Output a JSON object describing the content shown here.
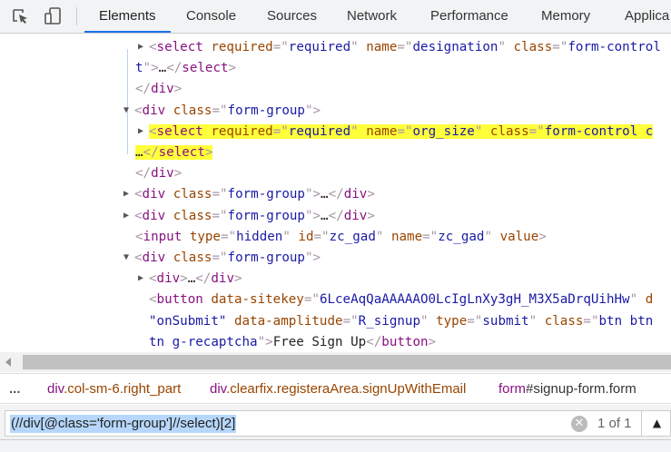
{
  "toolbar": {
    "tabs": [
      "Elements",
      "Console",
      "Sources",
      "Network",
      "Performance",
      "Memory",
      "Applica"
    ],
    "active": "Elements"
  },
  "tree": {
    "lines": [
      {
        "indent": 164,
        "tri": "▶",
        "tokens": [
          [
            "pun",
            "<"
          ],
          [
            "tag",
            "select"
          ],
          [
            "txt",
            " "
          ],
          [
            "attr",
            "required"
          ],
          [
            "pun",
            "=\""
          ],
          [
            "val",
            "required"
          ],
          [
            "pun",
            "\""
          ],
          [
            "txt",
            " "
          ],
          [
            "attr",
            "name"
          ],
          [
            "pun",
            "=\""
          ],
          [
            "val",
            "designation"
          ],
          [
            "pun",
            "\""
          ],
          [
            "txt",
            " "
          ],
          [
            "attr",
            "class"
          ],
          [
            "pun",
            "=\""
          ],
          [
            "val",
            "form-control"
          ]
        ]
      },
      {
        "indent": 149,
        "tokens": [
          [
            "val",
            "t"
          ],
          [
            "pun",
            "\">"
          ],
          [
            "txt",
            "…"
          ],
          [
            "pun",
            "</"
          ],
          [
            "tag",
            "select"
          ],
          [
            "pun",
            ">"
          ]
        ]
      },
      {
        "indent": 149,
        "tokens": [
          [
            "pun",
            "</"
          ],
          [
            "tag",
            "div"
          ],
          [
            "pun",
            ">"
          ]
        ]
      },
      {
        "indent": 148,
        "tri": "▼",
        "tokens": [
          [
            "pun",
            "<"
          ],
          [
            "tag",
            "div"
          ],
          [
            "txt",
            " "
          ],
          [
            "attr",
            "class"
          ],
          [
            "pun",
            "=\""
          ],
          [
            "val",
            "form-group"
          ],
          [
            "pun",
            "\">"
          ]
        ]
      },
      {
        "indent": 164,
        "tri": "▶",
        "hl": true,
        "tokens": [
          [
            "pun",
            "<"
          ],
          [
            "tag",
            "select"
          ],
          [
            "txt",
            " "
          ],
          [
            "attr",
            "required"
          ],
          [
            "pun",
            "=\""
          ],
          [
            "val",
            "required"
          ],
          [
            "pun",
            "\""
          ],
          [
            "txt",
            " "
          ],
          [
            "attr",
            "name"
          ],
          [
            "pun",
            "=\""
          ],
          [
            "val",
            "org_size"
          ],
          [
            "pun",
            "\""
          ],
          [
            "txt",
            " "
          ],
          [
            "attr",
            "class"
          ],
          [
            "pun",
            "=\""
          ],
          [
            "val",
            "form-control c"
          ]
        ]
      },
      {
        "indent": 149,
        "hl": true,
        "tokens": [
          [
            "txt",
            "…"
          ],
          [
            "pun",
            "</"
          ],
          [
            "tag",
            "select"
          ],
          [
            "pun",
            ">"
          ]
        ]
      },
      {
        "indent": 149,
        "tokens": [
          [
            "pun",
            "</"
          ],
          [
            "tag",
            "div"
          ],
          [
            "pun",
            ">"
          ]
        ]
      },
      {
        "indent": 148,
        "tri": "▶",
        "tokens": [
          [
            "pun",
            "<"
          ],
          [
            "tag",
            "div"
          ],
          [
            "txt",
            " "
          ],
          [
            "attr",
            "class"
          ],
          [
            "pun",
            "=\""
          ],
          [
            "val",
            "form-group"
          ],
          [
            "pun",
            "\">"
          ],
          [
            "txt",
            "…"
          ],
          [
            "pun",
            "</"
          ],
          [
            "tag",
            "div"
          ],
          [
            "pun",
            ">"
          ]
        ]
      },
      {
        "indent": 148,
        "tri": "▶",
        "tokens": [
          [
            "pun",
            "<"
          ],
          [
            "tag",
            "div"
          ],
          [
            "txt",
            " "
          ],
          [
            "attr",
            "class"
          ],
          [
            "pun",
            "=\""
          ],
          [
            "val",
            "form-group"
          ],
          [
            "pun",
            "\">"
          ],
          [
            "txt",
            "…"
          ],
          [
            "pun",
            "</"
          ],
          [
            "tag",
            "div"
          ],
          [
            "pun",
            ">"
          ]
        ]
      },
      {
        "indent": 149,
        "tokens": [
          [
            "pun",
            "<"
          ],
          [
            "tag",
            "input"
          ],
          [
            "txt",
            " "
          ],
          [
            "attr",
            "type"
          ],
          [
            "pun",
            "=\""
          ],
          [
            "val",
            "hidden"
          ],
          [
            "pun",
            "\""
          ],
          [
            "txt",
            " "
          ],
          [
            "attr",
            "id"
          ],
          [
            "pun",
            "=\""
          ],
          [
            "val",
            "zc_gad"
          ],
          [
            "pun",
            "\""
          ],
          [
            "txt",
            " "
          ],
          [
            "attr",
            "name"
          ],
          [
            "pun",
            "=\""
          ],
          [
            "val",
            "zc_gad"
          ],
          [
            "pun",
            "\""
          ],
          [
            "txt",
            " "
          ],
          [
            "attr",
            "value"
          ],
          [
            "pun",
            ">"
          ]
        ]
      },
      {
        "indent": 148,
        "tri": "▼",
        "tokens": [
          [
            "pun",
            "<"
          ],
          [
            "tag",
            "div"
          ],
          [
            "txt",
            " "
          ],
          [
            "attr",
            "class"
          ],
          [
            "pun",
            "=\""
          ],
          [
            "val",
            "form-group"
          ],
          [
            "pun",
            "\">"
          ]
        ]
      },
      {
        "indent": 164,
        "tri": "▶",
        "tokens": [
          [
            "pun",
            "<"
          ],
          [
            "tag",
            "div"
          ],
          [
            "pun",
            ">"
          ],
          [
            "txt",
            "…"
          ],
          [
            "pun",
            "</"
          ],
          [
            "tag",
            "div"
          ],
          [
            "pun",
            ">"
          ]
        ]
      },
      {
        "indent": 164,
        "tokens": [
          [
            "pun",
            "<"
          ],
          [
            "tag",
            "button"
          ],
          [
            "txt",
            " "
          ],
          [
            "attr",
            "data-sitekey"
          ],
          [
            "pun",
            "=\""
          ],
          [
            "val",
            "6LceAqQaAAAAAO0LcIgLnXy3gH_M3X5aDrqUihHw"
          ],
          [
            "pun",
            "\""
          ],
          [
            "txt",
            " "
          ],
          [
            "attr",
            "d"
          ]
        ]
      },
      {
        "indent": 164,
        "tokens": [
          [
            "val",
            "\"onSubmit\""
          ],
          [
            "txt",
            " "
          ],
          [
            "attr",
            "data-amplitude"
          ],
          [
            "pun",
            "=\""
          ],
          [
            "val",
            "R_signup"
          ],
          [
            "pun",
            "\""
          ],
          [
            "txt",
            " "
          ],
          [
            "attr",
            "type"
          ],
          [
            "pun",
            "=\""
          ],
          [
            "val",
            "submit"
          ],
          [
            "pun",
            "\""
          ],
          [
            "txt",
            " "
          ],
          [
            "attr",
            "class"
          ],
          [
            "pun",
            "=\""
          ],
          [
            "val",
            "btn btn"
          ]
        ]
      },
      {
        "indent": 164,
        "tokens": [
          [
            "val",
            "tn g-recaptcha"
          ],
          [
            "pun",
            "\">"
          ],
          [
            "txt",
            "Free Sign Up"
          ],
          [
            "pun",
            "</"
          ],
          [
            "tag",
            "button"
          ],
          [
            "pun",
            ">"
          ]
        ]
      }
    ]
  },
  "breadcrumbs": {
    "more": "...",
    "items": [
      {
        "tag": "div",
        "rest": ".col-sm-6.right_part"
      },
      {
        "tag": "div",
        "rest": ".clearfix.registeraArea.signUpWithEmail"
      },
      {
        "tag": "form",
        "rest": "#signup-form.form"
      }
    ]
  },
  "search": {
    "query": "(//div[@class='form-group']//select)[2]",
    "clear": "✕",
    "count": "1 of 1",
    "prev": "▲"
  }
}
